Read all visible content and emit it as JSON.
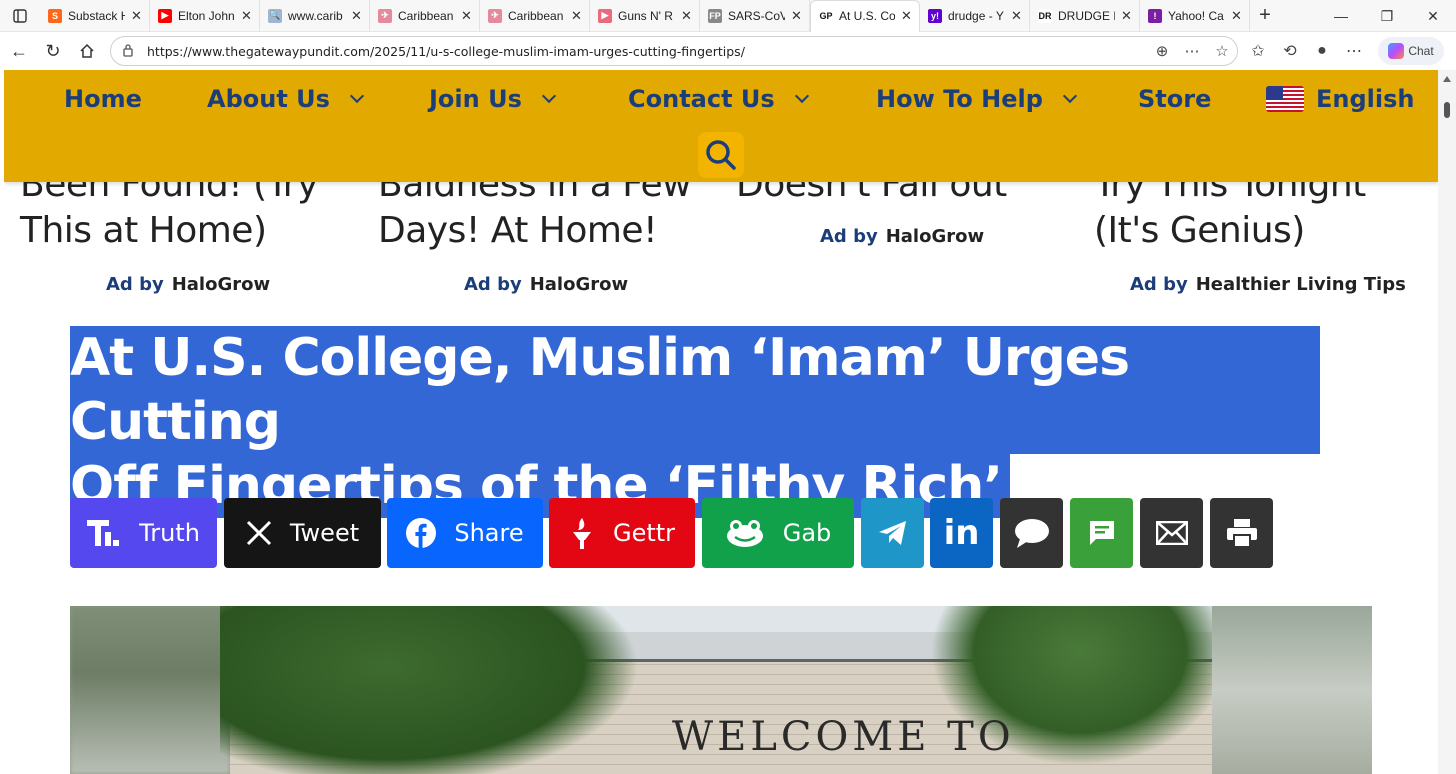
{
  "browser": {
    "tabs": [
      {
        "title": "Substack H",
        "favicon_color": "#ff6719",
        "favicon_glyph": "S"
      },
      {
        "title": "Elton John",
        "favicon_color": "#ff0000",
        "favicon_glyph": "▶"
      },
      {
        "title": "www.carib",
        "favicon_color": "#9fb6d3",
        "favicon_glyph": "🔍"
      },
      {
        "title": "Caribbean",
        "favicon_color": "#e58a9e",
        "favicon_glyph": "✈"
      },
      {
        "title": "Caribbean",
        "favicon_color": "#e58a9e",
        "favicon_glyph": "✈"
      },
      {
        "title": "Guns N' R",
        "favicon_color": "#e96b7c",
        "favicon_glyph": "▶"
      },
      {
        "title": "SARS-CoV",
        "favicon_color": "#888888",
        "favicon_glyph": "FP"
      },
      {
        "title": "At U.S. Co",
        "favicon_color": "#ffffff",
        "favicon_glyph": "GP",
        "active": true
      },
      {
        "title": "drudge - Y",
        "favicon_color": "#6001d2",
        "favicon_glyph": "y!"
      },
      {
        "title": "DRUDGE R",
        "favicon_color": "#ffffff",
        "favicon_glyph": "DR"
      },
      {
        "title": "Yahoo! Ca",
        "favicon_color": "#7b1fa2",
        "favicon_glyph": "!"
      }
    ],
    "url": "https://www.thegatewaypundit.com/2025/11/u-s-college-muslim-imam-urges-cutting-fingertips/",
    "chat_label": "Chat"
  },
  "nav": {
    "home": "Home",
    "about": "About Us",
    "join": "Join Us",
    "contact": "Contact Us",
    "help": "How To Help",
    "store": "Store",
    "language": "English"
  },
  "ads": [
    {
      "line1": "Been Found! (Try",
      "line2": "This at Home)",
      "label": "Ad by",
      "source": "HaloGrow"
    },
    {
      "line1": "Baldness in a Few",
      "line2": "Days! At Home!",
      "label": "Ad by",
      "source": "HaloGrow"
    },
    {
      "line1": "Doesn't Fall out",
      "line2": "",
      "label": "Ad by",
      "source": "HaloGrow"
    },
    {
      "line1": "Try This Tonight",
      "line2": "(It's Genius)",
      "label": "Ad by",
      "source": "Healthier Living Tips"
    }
  ],
  "article": {
    "headline_line1": "At U.S. College, Muslim ‘Imam’ Urges Cutting",
    "headline_line2": "Off Fingertips of the ‘Filthy Rich’",
    "selection_color": "#3367d6",
    "image_sign_text": "WELCOME TO"
  },
  "share": {
    "truth": {
      "label": "Truth",
      "color": "#5448ee"
    },
    "tweet": {
      "label": "Tweet",
      "color": "#151515"
    },
    "share": {
      "label": "Share",
      "color": "#0866ff"
    },
    "gettr": {
      "label": "Gettr",
      "color": "#e30613"
    },
    "gab": {
      "label": "Gab",
      "color": "#12a14b"
    },
    "telegram_color": "#1e96c8",
    "linkedin_color": "#0a66c2",
    "comment_color": "#333333",
    "sms_color": "#3aa03a",
    "email_color": "#333333",
    "print_color": "#333333"
  },
  "colors": {
    "nav_bg": "#e2a900",
    "nav_text": "#1b3e7a"
  }
}
